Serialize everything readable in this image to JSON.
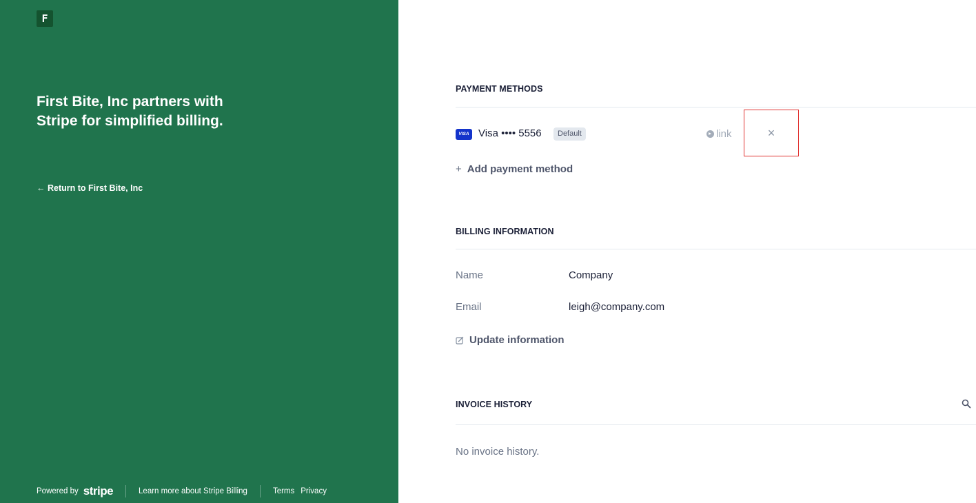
{
  "brand": {
    "logo_letter": "F",
    "headline": "First Bite, Inc partners with Stripe for simplified billing.",
    "return_link": "← Return to First Bite, Inc",
    "colors": {
      "panel": "#20744d",
      "logo_bg": "#14532f"
    }
  },
  "footer": {
    "powered_by": "Powered by",
    "stripe": "stripe",
    "learn_more": "Learn more about Stripe Billing",
    "terms": "Terms",
    "privacy": "Privacy"
  },
  "payment_methods": {
    "title": "PAYMENT METHODS",
    "cards": [
      {
        "brand_icon": "VISA",
        "label": "Visa •••• 5556",
        "badge": "Default",
        "wallet": "link",
        "remove_icon": "×"
      }
    ],
    "add_label": "Add payment method",
    "add_icon": "+"
  },
  "billing_information": {
    "title": "BILLING INFORMATION",
    "fields": [
      {
        "label": "Name",
        "value": "Company"
      },
      {
        "label": "Email",
        "value": "leigh@company.com"
      }
    ],
    "update_label": "Update information",
    "update_icon": "edit-icon"
  },
  "invoice_history": {
    "title": "INVOICE HISTORY",
    "search_icon": "search-icon",
    "empty_text": "No invoice history."
  }
}
